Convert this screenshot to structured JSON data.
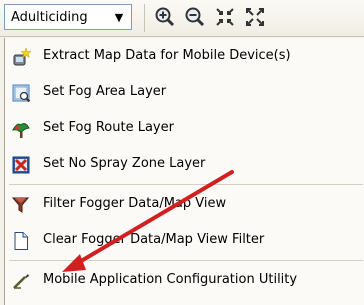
{
  "toolbar": {
    "combo_value": "Adulticiding",
    "icons": [
      "zoom-in-icon",
      "zoom-out-icon",
      "fixed-zoom-in-icon",
      "fixed-zoom-out-icon"
    ]
  },
  "menu": {
    "items": [
      {
        "label": "Extract Map Data for Mobile Device(s)",
        "icon": "extract-data-icon"
      },
      {
        "label": "Set Fog Area Layer",
        "icon": "fog-area-layer-icon"
      },
      {
        "label": "Set Fog Route Layer",
        "icon": "fog-route-layer-icon"
      },
      {
        "label": "Set No Spray Zone Layer",
        "icon": "no-spray-zone-icon"
      },
      {
        "label": "Filter Fogger Data/Map View",
        "icon": "filter-icon"
      },
      {
        "label": "Clear Fogger Data/Map View Filter",
        "icon": "clear-filter-icon"
      },
      {
        "label": "Mobile Application Configuration Utility",
        "icon": "configuration-utility-icon"
      }
    ]
  },
  "annotation": {
    "arrow_color": "#d22020"
  }
}
